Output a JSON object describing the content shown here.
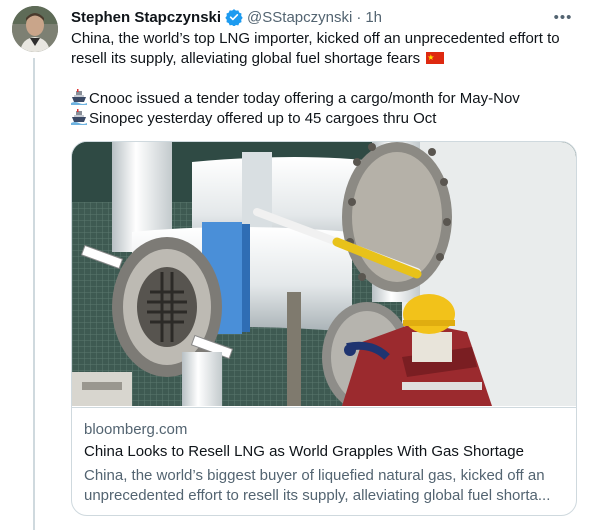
{
  "tweet": {
    "author_name": "Stephen Stapczynski",
    "handle": "@SStapczynski",
    "separator": "·",
    "time": "1h",
    "more_label": "•••",
    "avatar_icon": "person-photo",
    "verified_icon": "verified-badge-icon",
    "verified_color": "#1d9bf0",
    "text_line1": "China, the world’s top LNG importer, kicked off an unprecedented effort to resell its supply, alleviating global fuel shortage fears",
    "flag_icon": "china-flag-icon",
    "bullet_icon": "ship-icon",
    "bullet1": "Cnooc issued a tender today offering a cargo/month for May-Nov",
    "bullet2": "Sinopec yesterday offered up to 45 cargoes thru Oct"
  },
  "card": {
    "image_desc_icon": "lng-pipeline-photo",
    "domain": "bloomberg.com",
    "title": "China Looks to Resell LNG as World Grapples With Gas Shortage",
    "desc_line1": "China, the world’s biggest buyer of liquefied natural gas, kicked off an",
    "desc_line2": "unprecedented effort to resell its supply, alleviating global fuel shorta..."
  },
  "colors": {
    "text": "#0f1419",
    "secondary": "#536471",
    "border": "#cfd9de",
    "accent": "#1d9bf0"
  }
}
